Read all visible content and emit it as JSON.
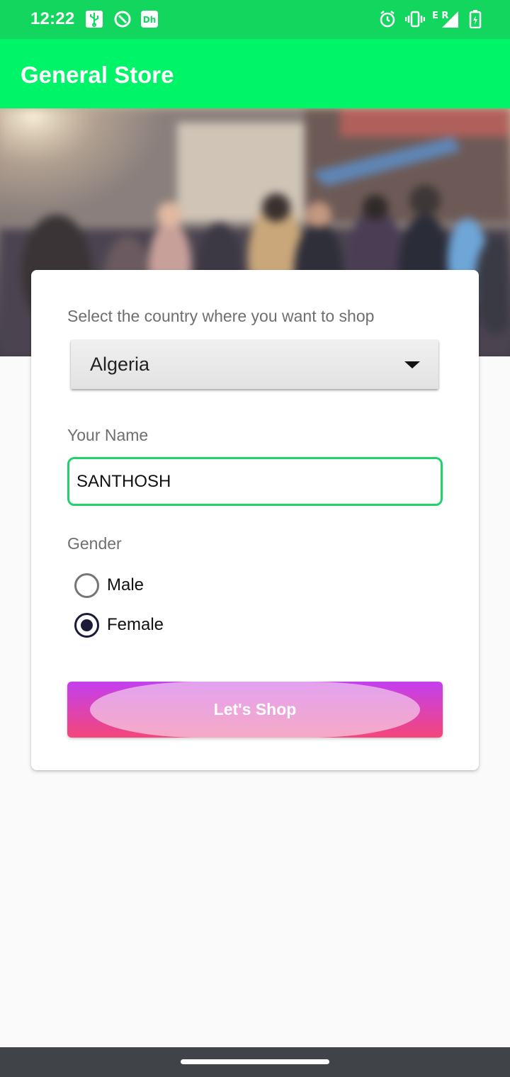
{
  "status_bar": {
    "time": "12:22",
    "left_icons": [
      "usb-icon",
      "data-saver-icon",
      "app-notification-icon"
    ],
    "right_icons": [
      "alarm-icon",
      "vibrate-icon",
      "signal-icon",
      "battery-charging-icon"
    ],
    "network_label": "E R"
  },
  "app_bar": {
    "title": "General Store"
  },
  "form": {
    "country_label": "Select the country where you want to shop",
    "country_value": "Algeria",
    "name_label": "Your Name",
    "name_value": "SANTHOSH",
    "gender_label": "Gender",
    "gender_options": [
      {
        "label": "Male",
        "selected": false
      },
      {
        "label": "Female",
        "selected": true
      }
    ],
    "submit_label": "Let's  Shop"
  },
  "colors": {
    "status_bar": "#12d65e",
    "app_bar": "#00f468",
    "input_focus": "#1fd369",
    "radio_selected": "#1b1b3a",
    "button_gradient_top": "#c33ff0",
    "button_gradient_bottom": "#f4467a",
    "nav_bar": "#404449"
  }
}
